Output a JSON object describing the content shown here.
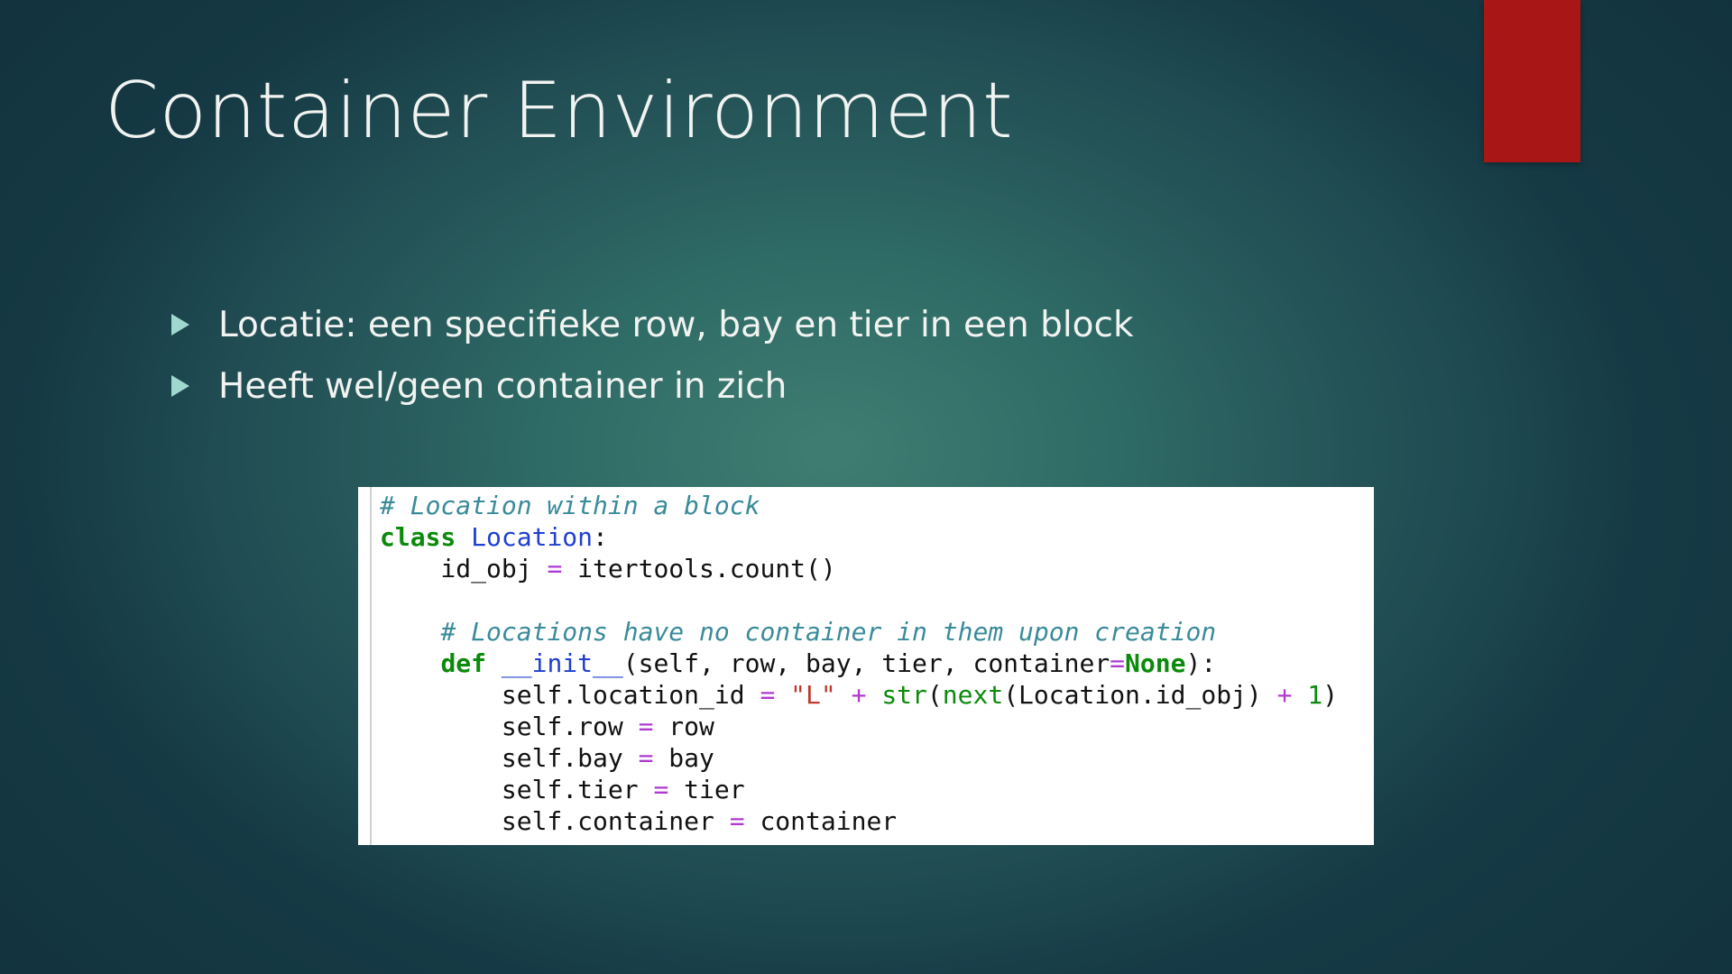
{
  "slide": {
    "title": "Container Environment",
    "bullets": [
      "Locatie: een specifieke row, bay en tier in een block",
      "Heeft wel/geen container in zich"
    ],
    "accent_color": "#a81716",
    "bullet_icon": "triangle-bullet-icon"
  },
  "code": {
    "lines": [
      [
        {
          "t": "# Location within a block",
          "k": "comment"
        }
      ],
      [
        {
          "t": "class",
          "k": "kw"
        },
        {
          "t": " ",
          "k": "plain"
        },
        {
          "t": "Location",
          "k": "cls"
        },
        {
          "t": ":",
          "k": "plain"
        }
      ],
      [
        {
          "t": "    id_obj ",
          "k": "plain"
        },
        {
          "t": "=",
          "k": "op"
        },
        {
          "t": " itertools.count()",
          "k": "plain"
        }
      ],
      [
        {
          "t": " ",
          "k": "plain"
        }
      ],
      [
        {
          "t": "    ",
          "k": "plain"
        },
        {
          "t": "# Locations have no container in them upon creation",
          "k": "comment"
        }
      ],
      [
        {
          "t": "    ",
          "k": "plain"
        },
        {
          "t": "def",
          "k": "kw"
        },
        {
          "t": " ",
          "k": "plain"
        },
        {
          "t": "__init__",
          "k": "fn"
        },
        {
          "t": "(self, row, bay, tier, container",
          "k": "plain"
        },
        {
          "t": "=",
          "k": "op"
        },
        {
          "t": "None",
          "k": "const"
        },
        {
          "t": "):",
          "k": "plain"
        }
      ],
      [
        {
          "t": "        self.location_id ",
          "k": "plain"
        },
        {
          "t": "=",
          "k": "op"
        },
        {
          "t": " ",
          "k": "plain"
        },
        {
          "t": "\"L\"",
          "k": "str"
        },
        {
          "t": " ",
          "k": "plain"
        },
        {
          "t": "+",
          "k": "op"
        },
        {
          "t": " ",
          "k": "plain"
        },
        {
          "t": "str",
          "k": "builtin"
        },
        {
          "t": "(",
          "k": "plain"
        },
        {
          "t": "next",
          "k": "builtin"
        },
        {
          "t": "(Location.id_obj) ",
          "k": "plain"
        },
        {
          "t": "+",
          "k": "op"
        },
        {
          "t": " ",
          "k": "plain"
        },
        {
          "t": "1",
          "k": "num"
        },
        {
          "t": ")",
          "k": "plain"
        }
      ],
      [
        {
          "t": "        self.row ",
          "k": "plain"
        },
        {
          "t": "=",
          "k": "op"
        },
        {
          "t": " row",
          "k": "plain"
        }
      ],
      [
        {
          "t": "        self.bay ",
          "k": "plain"
        },
        {
          "t": "=",
          "k": "op"
        },
        {
          "t": " bay",
          "k": "plain"
        }
      ],
      [
        {
          "t": "        self.tier ",
          "k": "plain"
        },
        {
          "t": "=",
          "k": "op"
        },
        {
          "t": " tier",
          "k": "plain"
        }
      ],
      [
        {
          "t": "        self.container ",
          "k": "plain"
        },
        {
          "t": "=",
          "k": "op"
        },
        {
          "t": " container",
          "k": "plain"
        }
      ]
    ]
  }
}
